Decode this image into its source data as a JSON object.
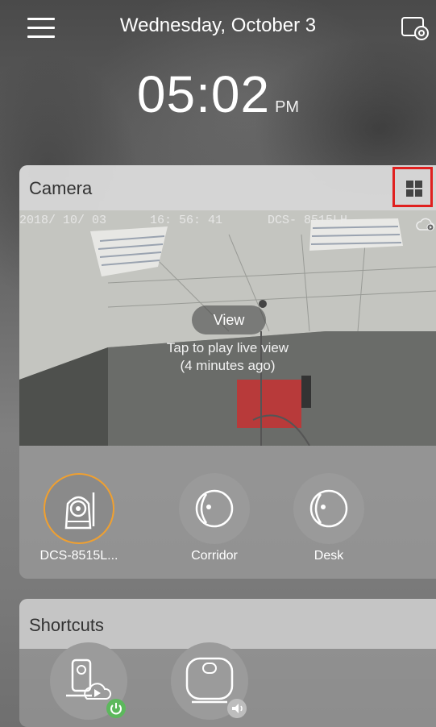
{
  "header": {
    "date": "Wednesday, October 3",
    "time": "05:02",
    "ampm": "PM",
    "menu_icon": "hamburger-menu-icon",
    "settings_icon": "settings-gear-icon"
  },
  "camera_card": {
    "title": "Camera",
    "layout_icon": "grid-layout-icon",
    "highlight_color": "#e0201f",
    "feed": {
      "osd_date": "2018/ 10/ 03",
      "osd_time": "16: 56: 41",
      "osd_device": "DCS- 8515LH",
      "cloud_icon": "cloud-play-icon",
      "view_label": "View",
      "tap_text": "Tap to play live view",
      "ago_text": "(4 minutes ago)"
    },
    "devices": [
      {
        "label": "DCS-8515L...",
        "icon": "pan-tilt-camera-icon",
        "selected": true
      },
      {
        "label": "Corridor",
        "icon": "cube-camera-icon",
        "selected": false
      },
      {
        "label": "Desk",
        "icon": "cube-camera-icon",
        "selected": false
      }
    ],
    "selected_color": "#f0a030"
  },
  "shortcuts_card": {
    "title": "Shortcuts",
    "items": [
      {
        "icon": "camera-cloud-play-icon",
        "badge": "power-icon",
        "badge_color": "#5cb85c"
      },
      {
        "icon": "siren-icon",
        "badge": "speaker-icon"
      }
    ]
  }
}
